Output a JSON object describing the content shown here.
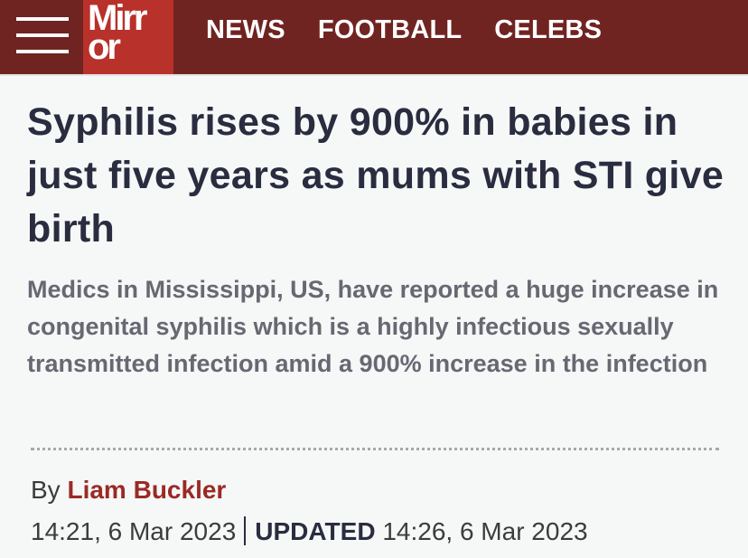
{
  "header": {
    "logo_line1": "Mirr",
    "logo_line2": "or",
    "nav": [
      "NEWS",
      "FOOTBALL",
      "CELEBS"
    ]
  },
  "article": {
    "headline": "Syphilis rises by 900% in babies in just five years as mums with STI give birth",
    "standfirst": "Medics in Mississippi, US, have reported a huge increase in congenital syphilis which is a highly infectious sexually transmitted infection amid a 900% increase in the infection",
    "byline_prefix": "By",
    "author": "Liam Buckler",
    "published": "14:21, 6 Mar 2023",
    "updated_label": "UPDATED",
    "updated": "14:26, 6 Mar 2023"
  },
  "colors": {
    "header_bg": "#702421",
    "logo_bg": "#b8312a",
    "headline": "#2a2c3f",
    "standfirst": "#676872",
    "author": "#9a2a25",
    "page_bg": "#f6f7f7"
  },
  "icons": {
    "menu": "hamburger-menu-icon"
  }
}
